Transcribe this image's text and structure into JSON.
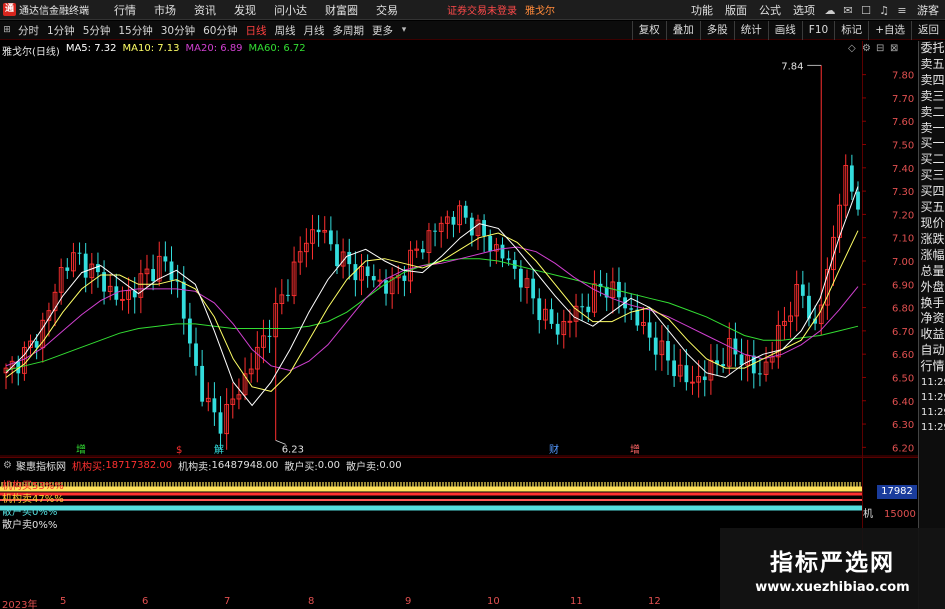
{
  "app": {
    "title": "通达信金融终端",
    "menu": [
      "行情",
      "市场",
      "资讯",
      "发现",
      "问小达",
      "财富圈",
      "交易"
    ],
    "notice": "证券交易未登录",
    "stock_tag": "雅戈尔",
    "right_menu": [
      "功能",
      "版面",
      "公式",
      "选项"
    ],
    "guest": "游客"
  },
  "periods": {
    "items": [
      "分时",
      "1分钟",
      "5分钟",
      "15分钟",
      "30分钟",
      "60分钟",
      "日线",
      "周线",
      "月线",
      "多周期",
      "更多"
    ],
    "active": "日线"
  },
  "tools": [
    "复权",
    "叠加",
    "多股",
    "统计",
    "画线",
    "F10",
    "标记",
    "+自选",
    "返回"
  ],
  "chart": {
    "stock_label": "雅戈尔(日线)",
    "ma": [
      {
        "name": "MA5",
        "value": "7.32"
      },
      {
        "name": "MA10",
        "value": "7.13"
      },
      {
        "name": "MA20",
        "value": "6.89"
      },
      {
        "name": "MA60",
        "value": "6.72"
      }
    ],
    "high_label": "7.84",
    "low_label": "6.23",
    "markers": [
      "增",
      "$",
      "解",
      "财",
      "增"
    ]
  },
  "chart_data": {
    "type": "candlestick",
    "title": "雅戈尔(日线)",
    "y_ticks": [
      "7.80",
      "7.70",
      "7.60",
      "7.50",
      "7.40",
      "7.30",
      "7.20",
      "7.10",
      "7.00",
      "6.90",
      "6.80",
      "6.70",
      "6.60",
      "6.50",
      "6.40",
      "6.30",
      "6.20"
    ],
    "ylim": [
      6.18,
      7.88
    ],
    "max_price": 7.84,
    "min_price": 6.23,
    "close_path": [
      6.52,
      6.58,
      6.65,
      6.78,
      6.98,
      7.02,
      6.96,
      6.9,
      6.82,
      6.88,
      6.95,
      7.0,
      6.92,
      6.62,
      6.4,
      6.3,
      6.4,
      6.52,
      6.65,
      6.78,
      6.92,
      7.08,
      7.15,
      7.05,
      6.98,
      6.95,
      6.92,
      6.88,
      6.96,
      7.05,
      7.12,
      7.18,
      7.2,
      7.15,
      7.08,
      7.02,
      6.95,
      6.85,
      6.75,
      6.7,
      6.78,
      6.82,
      6.9,
      6.86,
      6.78,
      6.7,
      6.62,
      6.55,
      6.48,
      6.5,
      6.56,
      6.62,
      6.58,
      6.5,
      6.62,
      6.78,
      6.88,
      6.7,
      7.0,
      7.38,
      7.26
    ],
    "ma_levels": {
      "ma5": [
        6.52,
        6.6,
        6.72,
        6.85,
        6.95,
        6.98,
        6.92,
        6.86,
        6.92,
        6.96,
        6.9,
        6.7,
        6.48,
        6.38,
        6.48,
        6.62,
        6.78,
        6.92,
        7.02,
        7.05,
        7.0,
        6.96,
        6.95,
        7.02,
        7.1,
        7.16,
        7.14,
        7.05,
        6.95,
        6.85,
        6.76,
        6.72,
        6.78,
        6.84,
        6.8,
        6.7,
        6.6,
        6.52,
        6.5,
        6.56,
        6.6,
        6.62,
        6.7,
        6.84,
        7.1,
        7.32
      ],
      "ma10": [
        6.5,
        6.56,
        6.66,
        6.78,
        6.88,
        6.94,
        6.94,
        6.9,
        6.9,
        6.92,
        6.88,
        6.76,
        6.58,
        6.46,
        6.44,
        6.52,
        6.66,
        6.8,
        6.92,
        7.0,
        7.01,
        6.99,
        6.97,
        7.0,
        7.05,
        7.1,
        7.12,
        7.08,
        7.0,
        6.9,
        6.8,
        6.74,
        6.74,
        6.78,
        6.8,
        6.75,
        6.66,
        6.58,
        6.54,
        6.54,
        6.58,
        6.62,
        6.66,
        6.78,
        6.96,
        7.13
      ],
      "ma20": [
        6.55,
        6.58,
        6.63,
        6.7,
        6.77,
        6.83,
        6.87,
        6.88,
        6.88,
        6.88,
        6.87,
        6.82,
        6.73,
        6.62,
        6.55,
        6.53,
        6.57,
        6.64,
        6.74,
        6.84,
        6.92,
        6.96,
        6.98,
        6.99,
        7.01,
        7.03,
        7.05,
        7.06,
        7.04,
        6.99,
        6.93,
        6.88,
        6.84,
        6.81,
        6.79,
        6.76,
        6.72,
        6.68,
        6.64,
        6.6,
        6.58,
        6.6,
        6.64,
        6.7,
        6.79,
        6.89
      ],
      "ma60": [
        6.53,
        6.55,
        6.57,
        6.6,
        6.63,
        6.66,
        6.69,
        6.71,
        6.72,
        6.73,
        6.73,
        6.72,
        6.71,
        6.71,
        6.71,
        6.71,
        6.72,
        6.74,
        6.78,
        6.84,
        6.9,
        6.95,
        6.98,
        7.0,
        7.01,
        7.01,
        7.0,
        6.98,
        6.96,
        6.94,
        6.92,
        6.9,
        6.88,
        6.86,
        6.84,
        6.82,
        6.79,
        6.76,
        6.72,
        6.68,
        6.66,
        6.66,
        6.67,
        6.68,
        6.7,
        6.72
      ]
    },
    "date_labels": [
      "2023年",
      "5",
      "6",
      "7",
      "8",
      "9",
      "10",
      "11",
      "12"
    ]
  },
  "side_panel": {
    "items": [
      "委托",
      "卖五",
      "卖四",
      "卖三",
      "卖二",
      "卖一",
      "买一",
      "买二",
      "买三",
      "买四",
      "买五",
      "现价",
      "涨跌",
      "涨幅",
      "总量",
      "外盘",
      "换手",
      "净资",
      "收益",
      "自动",
      "行情"
    ],
    "times": [
      "11:29",
      "11:29",
      "11:29",
      "11:29"
    ]
  },
  "indicator": {
    "name": "聚惠指标网",
    "fields": [
      {
        "label": "机构买:",
        "value": "18717382.00",
        "red": true
      },
      {
        "label": "机构卖:",
        "value": "16487948.00",
        "red": false
      },
      {
        "label": "散户买:",
        "value": "0.00",
        "red": false
      },
      {
        "label": "散户卖:",
        "value": "0.00",
        "red": false
      }
    ],
    "line_labels": [
      "机构买53%%",
      "机构卖47%%",
      "散户买0%%",
      "散户卖0%%"
    ],
    "axis_box": "17982",
    "axis_value": "15000",
    "end_marker": "机"
  },
  "watermark": {
    "title": "指标严选网",
    "url": "www.xuezhibiao.com"
  },
  "colors": {
    "up": "#ff3030",
    "down": "#33dddd",
    "ma5": "#ffffff",
    "ma10": "#ffff66",
    "ma20": "#d040d0",
    "ma60": "#33dd33",
    "axis_text": "#e03030",
    "price_axis_text": "#e05050"
  }
}
